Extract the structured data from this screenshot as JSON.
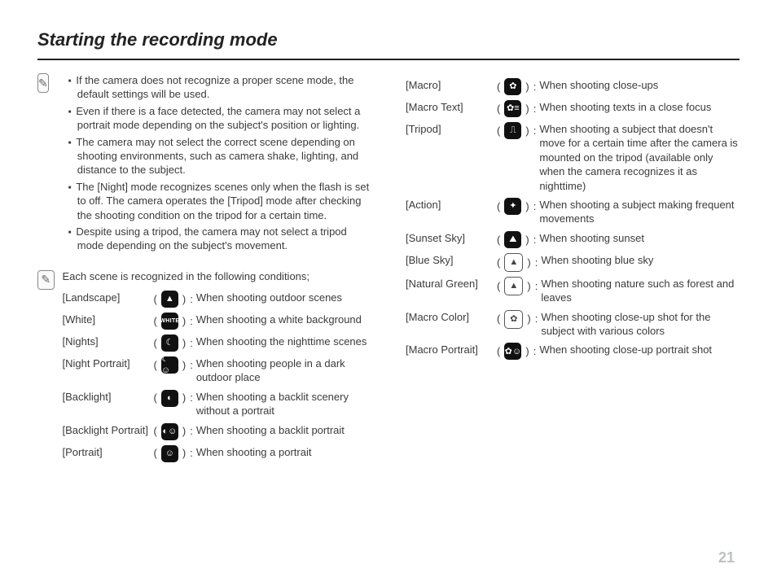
{
  "heading": "Starting the recording mode",
  "page_number": "21",
  "note_icon": "✎",
  "top_notes": [
    "If the camera does not recognize a proper scene mode, the default settings will be used.",
    "Even if there is a face detected, the camera may not select a portrait mode depending on the subject's position or lighting.",
    "The camera may not select the correct scene depending on shooting environments, such as camera shake, lighting, and distance to the subject.",
    "The [Night] mode recognizes scenes only when the flash is set to off. The camera operates the [Tripod] mode after checking the shooting condition on the tripod for a certain time.",
    "Despite using a tripod, the camera may not select a tripod mode depending on the subject's movement."
  ],
  "conditions_lead": "Each scene is recognized in the following conditions;",
  "scenes_left": [
    {
      "name": "[Landscape]",
      "glyph": "▲",
      "desc": "When shooting outdoor scenes"
    },
    {
      "name": "[White]",
      "glyph": "WHITE",
      "glyph_class": "white-text",
      "desc": "When shooting a white background"
    },
    {
      "name": "[Nights]",
      "glyph": "☾",
      "desc": "When shooting the nighttime scenes"
    },
    {
      "name": "[Night Portrait]",
      "glyph": "☾☺",
      "desc": "When shooting people in a dark outdoor place"
    },
    {
      "name": "[Backlight]",
      "glyph": "◐",
      "desc": "When shooting a backlit scenery without a portrait"
    },
    {
      "name": "[Backlight Portrait]",
      "glyph": "◐☺",
      "desc": "When shooting a backlit portrait"
    },
    {
      "name": "[Portrait]",
      "glyph": "☺",
      "desc": "When shooting a portrait"
    }
  ],
  "scenes_right": [
    {
      "name": "[Macro]",
      "glyph": "✿",
      "desc": "When shooting close-ups"
    },
    {
      "name": "[Macro Text]",
      "glyph": "✿≡",
      "desc": "When shooting texts in a close focus"
    },
    {
      "name": "[Tripod]",
      "glyph": "⎍",
      "desc": "When shooting a subject that doesn't move for a certain time after the camera is mounted on the tripod (available only when the camera recognizes it as nighttime)"
    },
    {
      "name": "[Action]",
      "glyph": "✦",
      "desc": "When shooting a subject making frequent movements"
    },
    {
      "name": "[Sunset Sky]",
      "glyph": "⛰",
      "desc": "When shooting sunset"
    },
    {
      "name": "[Blue Sky]",
      "glyph": "▲",
      "glyph_class": "outline",
      "desc": "When shooting blue sky"
    },
    {
      "name": "[Natural Green]",
      "glyph": "▲",
      "glyph_class": "outline",
      "desc": "When shooting nature such as forest and leaves"
    },
    {
      "name": "[Macro Color]",
      "glyph": "✿",
      "glyph_class": "outline",
      "desc": "When shooting close-up shot for the subject with various colors"
    },
    {
      "name": "[Macro Portrait]",
      "glyph": "✿☺",
      "desc": "When shooting close-up portrait shot"
    }
  ]
}
